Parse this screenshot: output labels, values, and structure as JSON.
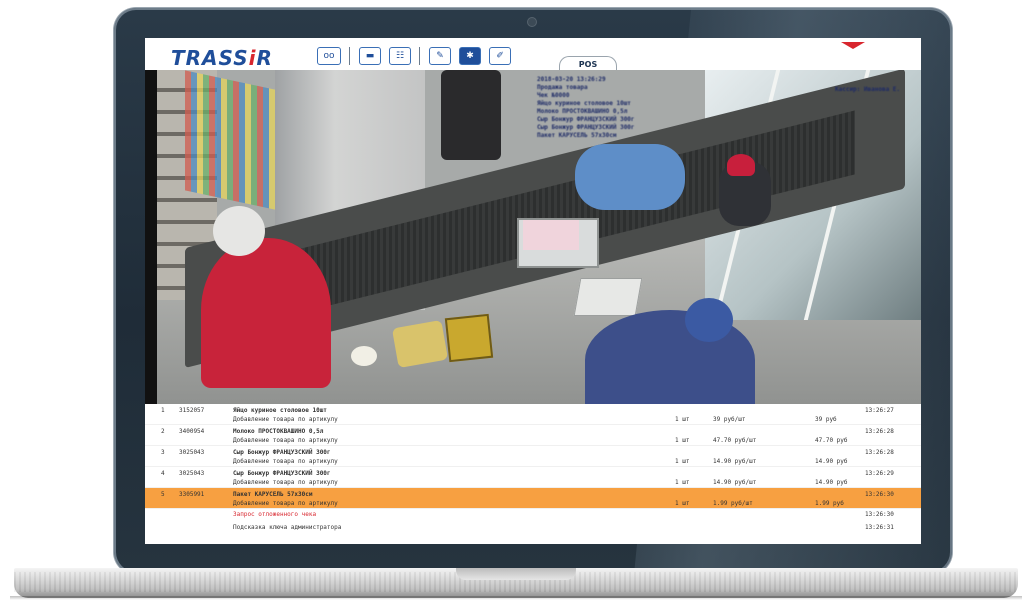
{
  "app": {
    "logo_text": "TRASS",
    "logo_accent_i": "i",
    "logo_accent_r": "R",
    "brand_color": "#1f4e9a",
    "accent_color": "#d8262e",
    "selected_row_color": "#f7a041"
  },
  "toolbar": {
    "buttons": [
      {
        "icon": "record-icon",
        "glyph": "oo"
      },
      {
        "icon": "single-view-icon",
        "glyph": "▬"
      },
      {
        "icon": "layout-icon",
        "glyph": "☷"
      },
      {
        "icon": "magic-wand-icon",
        "glyph": "✎"
      },
      {
        "icon": "puzzle-icon",
        "glyph": "✱"
      },
      {
        "icon": "edit-layout-icon",
        "glyph": "✐"
      }
    ],
    "tab_label": "POS"
  },
  "feed": {
    "overlay_lines": [
      "2018-03-20 13:26:29",
      "Продажа товара",
      "Чек №0000",
      "Яйцо куриное столовое 10шт",
      "Молоко ПРОСТОКВАШИНО 0,5л",
      "Сыр Бонжур ФРАНЦУЗСКИЙ 300г",
      "Сыр Бонжур ФРАНЦУЗСКИЙ 300г",
      "Пакет КАРУСЕЛЬ 57x30см"
    ],
    "overlay_right": "Кассир: Иванова Е."
  },
  "pos": {
    "rows": [
      {
        "idx": "1",
        "code": "3152057",
        "name": "Яйцо куриное столовое 10шт",
        "action": "Добавление товара по артикулу",
        "qty": "1 шт",
        "price": "39 руб/шт",
        "sum": "39 руб",
        "time": "13:26:27",
        "selected": false
      },
      {
        "idx": "2",
        "code": "3400954",
        "name": "Молоко ПРОСТОКВАШИНО 0,5л",
        "action": "Добавление товара по артикулу",
        "qty": "1 шт",
        "price": "47.70 руб/шт",
        "sum": "47.70 руб",
        "time": "13:26:28",
        "selected": false
      },
      {
        "idx": "3",
        "code": "3025043",
        "name": "Сыр Бонжур ФРАНЦУЗСКИЙ 300г",
        "action": "Добавление товара по артикулу",
        "qty": "1 шт",
        "price": "14.90 руб/шт",
        "sum": "14.90 руб",
        "time": "13:26:28",
        "selected": false
      },
      {
        "idx": "4",
        "code": "3025043",
        "name": "Сыр Бонжур ФРАНЦУЗСКИЙ 300г",
        "action": "Добавление товара по артикулу",
        "qty": "1 шт",
        "price": "14.90 руб/шт",
        "sum": "14.90 руб",
        "time": "13:26:29",
        "selected": false
      },
      {
        "idx": "5",
        "code": "3305991",
        "name": "Пакет КАРУСЕЛЬ 57x30см",
        "action": "Добавление товара по артикулу",
        "qty": "1 шт",
        "price": "1.99 руб/шт",
        "sum": "1.99 руб",
        "time": "13:26:30",
        "selected": true
      }
    ],
    "events": [
      {
        "msg": "Запрос отложенного чека",
        "time": "13:26:30",
        "red": true
      },
      {
        "msg": "Подсказка ключа администратора",
        "time": "13:26:31",
        "red": false
      }
    ]
  }
}
